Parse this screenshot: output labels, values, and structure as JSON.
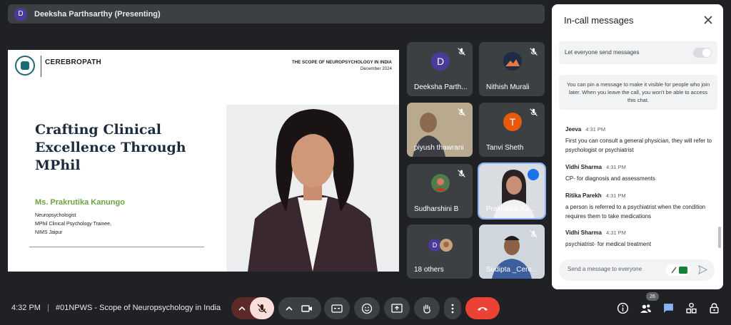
{
  "presenter": {
    "avatar_letter": "D",
    "label": "Deeksha Parthsarthy (Presenting)"
  },
  "slide": {
    "brand": "CEREBROPATH",
    "deck_title": "THE SCOPE OF NEUROPSYCHOLOGY IN INDIA",
    "deck_date": "December 2024",
    "heading_line1": "Crafting Clinical",
    "heading_line2": "Excellence Through",
    "heading_line3": "MPhil",
    "speaker": "Ms. Prakrutika Kanungo",
    "role1": "Neuropsychologist",
    "role2": "MPhil Clinical Psychology Trainee,",
    "role3": "NIMS Jaipur"
  },
  "tiles": [
    {
      "name": "Deeksha Parth...",
      "avatar": "D",
      "color": "#4a3b9a"
    },
    {
      "name": "Nithish Murali"
    },
    {
      "name": "piyush thawrani"
    },
    {
      "name": "Tanvi Sheth",
      "avatar": "T",
      "color": "#e8590c"
    },
    {
      "name": "Sudharshini B"
    },
    {
      "name": "Prakrutika Ka..."
    },
    {
      "name": "18 others",
      "avatar": "D",
      "color": "#4a3b9a"
    },
    {
      "name": "Sudipta _Cere..."
    }
  ],
  "chat": {
    "title": "In-call messages",
    "setting_label": "Let everyone send messages",
    "pin_note": "You can pin a message to make it visible for people who join later. When you leave the call, you won't be able to access this chat.",
    "messages": [
      {
        "sender": "Jeeva",
        "time": "4:31 PM",
        "text": "First you can consult a general physician, they will refer to psychologist or psychiatrist"
      },
      {
        "sender": "Vidhi Sharma",
        "time": "4:31 PM",
        "text": "CP- for diagnosis and assessments"
      },
      {
        "sender": "Ritika Parekh",
        "time": "4:31 PM",
        "text": "a person is referred to a psychiatrist when the condition requires them to take medications"
      },
      {
        "sender": "Vidhi Sharma",
        "time": "4:31 PM",
        "text": "psychiatrist- for medical treatment"
      }
    ],
    "compose_placeholder": "Send a message to everyone"
  },
  "toolbar": {
    "clock": "4:32 PM",
    "separator": "|",
    "meeting_title": "#01NPWS - Scope of Neuropsychology in India",
    "people_count": "26"
  },
  "colors": {
    "accent_blue": "#8ab4f8",
    "end_call": "#ea4335",
    "mic_muted": "#f9dedc"
  }
}
